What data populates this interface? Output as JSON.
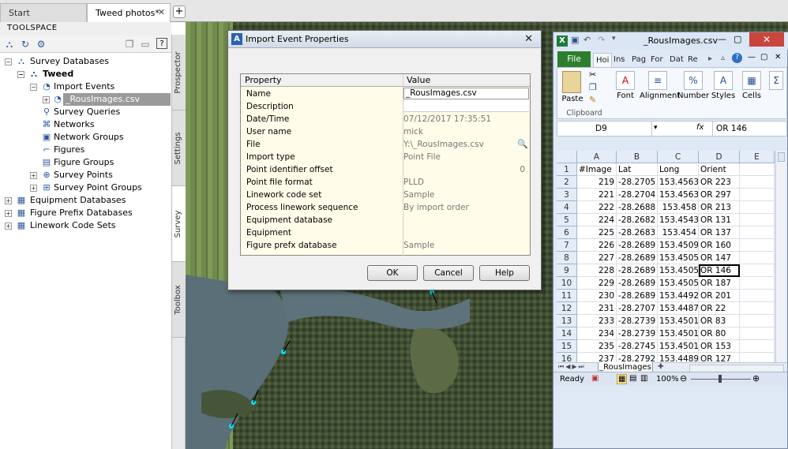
{
  "doc_tabs": [
    {
      "label": "Start"
    },
    {
      "label": "Tweed photos*"
    }
  ],
  "toolspace": {
    "title": "TOOLSPACE",
    "tree": [
      {
        "label": "Survey Databases"
      },
      {
        "label": "Tweed"
      },
      {
        "label": "Import Events"
      },
      {
        "label": "_RousImages.csv"
      },
      {
        "label": "Survey Queries"
      },
      {
        "label": "Networks"
      },
      {
        "label": "Network Groups"
      },
      {
        "label": "Figures"
      },
      {
        "label": "Figure Groups"
      },
      {
        "label": "Survey Points"
      },
      {
        "label": "Survey Point Groups"
      },
      {
        "label": "Equipment Databases"
      },
      {
        "label": "Figure Prefix Databases"
      },
      {
        "label": "Linework Code Sets"
      }
    ],
    "side_tabs": [
      "Prospector",
      "Settings",
      "Survey",
      "Toolbox"
    ]
  },
  "dialog": {
    "title": "Import Event Properties",
    "col_property": "Property",
    "col_value": "Value",
    "rows": [
      {
        "k": "Name",
        "v": "_RousImages.csv"
      },
      {
        "k": "Description",
        "v": ""
      },
      {
        "k": "Date/Time",
        "v": "07/12/2017 17:35:51"
      },
      {
        "k": "User name",
        "v": "mick"
      },
      {
        "k": "File",
        "v": "Y:\\_RousImages.csv"
      },
      {
        "k": "Import type",
        "v": "Point File"
      },
      {
        "k": "Point identifier offset",
        "v": "0"
      },
      {
        "k": "Point file format",
        "v": "PLLD"
      },
      {
        "k": "Linework code set",
        "v": "Sample"
      },
      {
        "k": "Process linework sequence",
        "v": "By import order"
      },
      {
        "k": "Equipment database",
        "v": ""
      },
      {
        "k": "Equipment",
        "v": ""
      },
      {
        "k": "Figure prefx database",
        "v": "Sample"
      }
    ],
    "ok": "OK",
    "cancel": "Cancel",
    "help": "Help"
  },
  "excel": {
    "title": "_RousImages.csv",
    "file_tab": "File",
    "ribbon_tabs": [
      "Hoi",
      "Ins",
      "Pag",
      "For",
      "Dat",
      "Re"
    ],
    "groups": {
      "paste": "Paste",
      "clipboard": "Clipboard",
      "font": "Font",
      "alignment": "Alignment",
      "number": "Number",
      "styles": "Styles",
      "cells": "Cells"
    },
    "name_box": "D9",
    "fx": "fx",
    "formula": "OR 146",
    "col_headers": [
      "A",
      "B",
      "C",
      "D",
      "E"
    ],
    "rows": [
      [
        "#Image",
        "Lat",
        "Long",
        "Orient"
      ],
      [
        "219",
        "-28.2705",
        "153.4563",
        "OR 223"
      ],
      [
        "221",
        "-28.2704",
        "153.4563",
        "OR 297"
      ],
      [
        "222",
        "-28.2688",
        "153.458",
        "OR 213"
      ],
      [
        "224",
        "-28.2682",
        "153.4543",
        "OR 131"
      ],
      [
        "225",
        "-28.2683",
        "153.454",
        "OR 137"
      ],
      [
        "226",
        "-28.2689",
        "153.4509",
        "OR 160"
      ],
      [
        "227",
        "-28.2689",
        "153.4505",
        "OR 147"
      ],
      [
        "228",
        "-28.2689",
        "153.4505",
        "OR 146"
      ],
      [
        "229",
        "-28.2689",
        "153.4505",
        "OR 187"
      ],
      [
        "230",
        "-28.2689",
        "153.4492",
        "OR 201"
      ],
      [
        "231",
        "-28.2707",
        "153.4487",
        "OR 22"
      ],
      [
        "233",
        "-28.2739",
        "153.4501",
        "OR 83"
      ],
      [
        "234",
        "-28.2739",
        "153.4501",
        "OR 80"
      ],
      [
        "235",
        "-28.2745",
        "153.4501",
        "OR 153"
      ],
      [
        "237",
        "-28.2792",
        "153.4489",
        "OR 127"
      ]
    ],
    "sheet_tab": "_RousImages",
    "status_ready": "Ready",
    "zoom": "100%"
  }
}
